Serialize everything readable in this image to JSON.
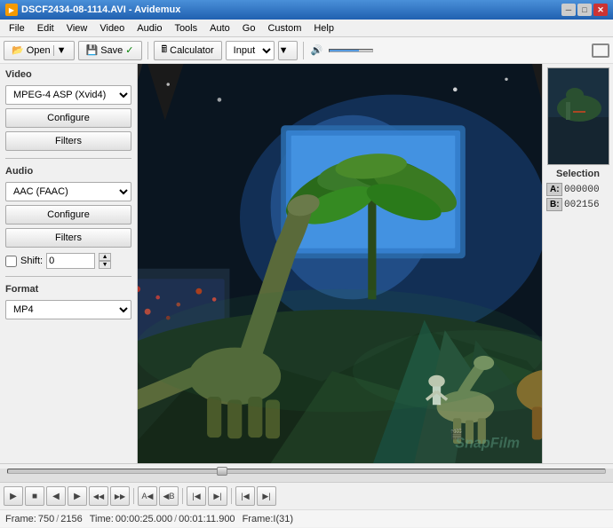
{
  "window": {
    "title": "DSCF2434-08-1114.AVI - Avidemux"
  },
  "titlebar": {
    "controls": {
      "min": "─",
      "max": "□",
      "close": "✕"
    }
  },
  "menubar": {
    "items": [
      "File",
      "Edit",
      "View",
      "Video",
      "Audio",
      "Tools",
      "Auto",
      "Go",
      "Custom",
      "Help"
    ]
  },
  "toolbar": {
    "open_label": "Open",
    "save_label": "Save",
    "calculator_label": "Calculator",
    "input_label": "Input"
  },
  "sidebar": {
    "video_section": "Video",
    "video_codec": "MPEG-4 ASP (Xvid4)",
    "video_configure": "Configure",
    "video_filters": "Filters",
    "audio_section": "Audio",
    "audio_codec": "AAC (FAAC)",
    "audio_configure": "Configure",
    "audio_filters": "Filters",
    "shift_label": "Shift:",
    "shift_value": "0",
    "format_section": "Format",
    "format_value": "MP4"
  },
  "selection": {
    "label": "Selection",
    "a_key": "A:",
    "a_value": "000000",
    "b_key": "B:",
    "b_value": "002156"
  },
  "controls": {
    "play": "▶",
    "stop": "■",
    "prev_frame": "◀",
    "next_frame": "▶",
    "rewind": "◀◀",
    "fast_forward": "▶▶",
    "mark_in": "A",
    "mark_out": "B",
    "go_start": "|◀",
    "go_end": "▶|",
    "go_mark_in": "|A",
    "go_mark_out": "B|"
  },
  "statusbar": {
    "frame_label": "Frame:",
    "frame_value": "750",
    "frame_total": "2156",
    "time_label": "Time:",
    "time_value": "00:00:25.000",
    "time_total": "00:01:11.900",
    "frame_type": "Frame:I(31)"
  },
  "colors": {
    "title_bg": "#3a78c9",
    "accent": "#4a90d9"
  }
}
